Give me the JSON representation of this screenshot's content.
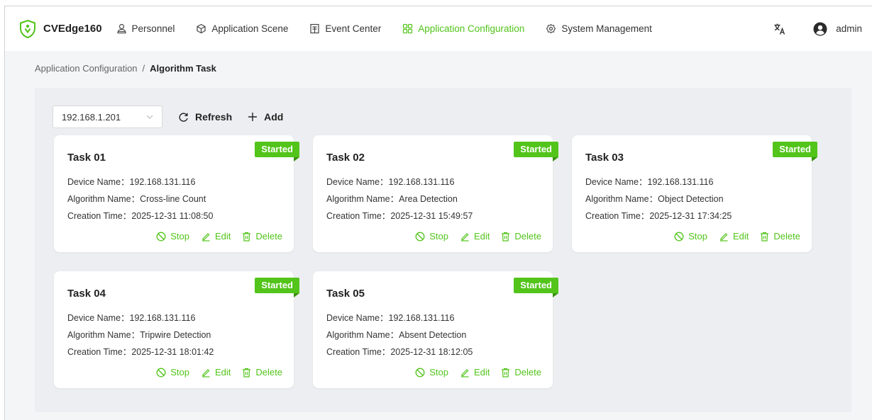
{
  "app": {
    "name": "CVEdge160",
    "brand_color": "#52c41a"
  },
  "nav": [
    {
      "label": "Personnel",
      "icon": "user-icon"
    },
    {
      "label": "Application Scene",
      "icon": "cube-icon"
    },
    {
      "label": "Event Center",
      "icon": "document-icon"
    },
    {
      "label": "Application Configuration",
      "icon": "grid-icon",
      "active": true
    },
    {
      "label": "System Management",
      "icon": "gear-icon"
    }
  ],
  "user": {
    "name": "admin"
  },
  "breadcrumb": {
    "parent": "Application Configuration",
    "separator": "/",
    "current": "Algorithm Task"
  },
  "toolbar": {
    "device_select": "192.168.1.201",
    "refresh_label": "Refresh",
    "add_label": "Add"
  },
  "labels": {
    "device_name": "Device Name：",
    "algorithm_name": "Algorithm Name：",
    "creation_time": "Creation Time：",
    "stop": "Stop",
    "edit": "Edit",
    "delete": "Delete"
  },
  "tasks": [
    {
      "title": "Task 01",
      "status": "Started",
      "device": "192.168.131.116",
      "algorithm": "Cross-line Count",
      "time": "2025-12-31 11:08:50"
    },
    {
      "title": "Task 02",
      "status": "Started",
      "device": "192.168.131.116",
      "algorithm": "Area Detection",
      "time": "2025-12-31 15:49:57"
    },
    {
      "title": "Task 03",
      "status": "Started",
      "device": "192.168.131.116",
      "algorithm": "Object Detection",
      "time": "2025-12-31 17:34:25"
    },
    {
      "title": "Task 04",
      "status": "Started",
      "device": "192.168.131.116",
      "algorithm": "Tripwire Detection",
      "time": "2025-12-31 18:01:42"
    },
    {
      "title": "Task 05",
      "status": "Started",
      "device": "192.168.131.116",
      "algorithm": "Absent Detection",
      "time": "2025-12-31 18:12:05"
    }
  ]
}
